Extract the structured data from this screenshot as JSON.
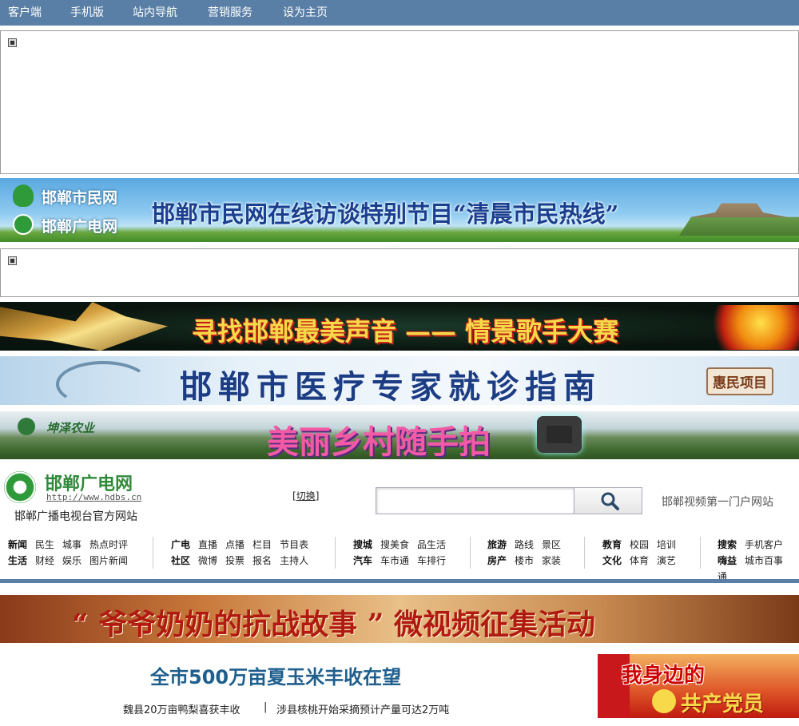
{
  "topnav": [
    "客户端",
    "手机版",
    "站内导航",
    "营销服务",
    "设为主页"
  ],
  "banners": {
    "b1": {
      "logo1": "邯郸市民网",
      "logo2": "邯郸广电网",
      "title": "邯郸市民网在线访谈特别节目“清晨市民热线”"
    },
    "b2": {
      "title": "寻找邯郸最美声音 —— 情景歌手大赛"
    },
    "b3": {
      "title": "邯郸市医疗专家就诊指南",
      "badge": "惠民项目"
    },
    "b4": {
      "brand": "坤泽农业",
      "title": "美丽乡村随手拍"
    },
    "b5": {
      "title": "“ 爷爷奶奶的抗战故事 ” 微视频征集活动"
    }
  },
  "header": {
    "logo_name": "邯郸广电网",
    "logo_url": "http://www.hdbs.cn",
    "logo_sub": "邯郸广播电视台官方网站",
    "switch_label": "切换",
    "search_placeholder": "",
    "tagline": "邯郸视频第一门户网站"
  },
  "nav": {
    "g1": {
      "r1": [
        "新闻",
        "民生",
        "城事",
        "热点时评"
      ],
      "r2": [
        "生活",
        "财经",
        "娱乐",
        "图片新闻"
      ]
    },
    "g2": {
      "r1": [
        "广电",
        "直播",
        "点播",
        "栏目",
        "节目表"
      ],
      "r2": [
        "社区",
        "微博",
        "投票",
        "报名",
        "主持人"
      ]
    },
    "g3": {
      "r1": [
        "搜城",
        "搜美食",
        "品生活"
      ],
      "r2": [
        "汽车",
        "车市通",
        "车排行"
      ]
    },
    "g4": {
      "r1": [
        "旅游",
        "路线",
        "景区"
      ],
      "r2": [
        "房产",
        "楼市",
        "家装"
      ]
    },
    "g5": {
      "r1": [
        "教育",
        "校园",
        "培训"
      ],
      "r2": [
        "文化",
        "体育",
        "演艺"
      ]
    },
    "g6": {
      "r1": [
        "搜索",
        "手机客户"
      ],
      "r2": [
        "嗨益",
        "城市百事"
      ],
      "r3": "通"
    }
  },
  "news": {
    "headline": "全市500万亩夏玉米丰收在望",
    "sub1": "魏县20万亩鸭梨喜获丰收",
    "divider": "|",
    "sub2": "涉县核桃开始采摘预计产量可达2万吨"
  },
  "side_banner": {
    "line1": "我身边的",
    "line2": "共产党员"
  }
}
